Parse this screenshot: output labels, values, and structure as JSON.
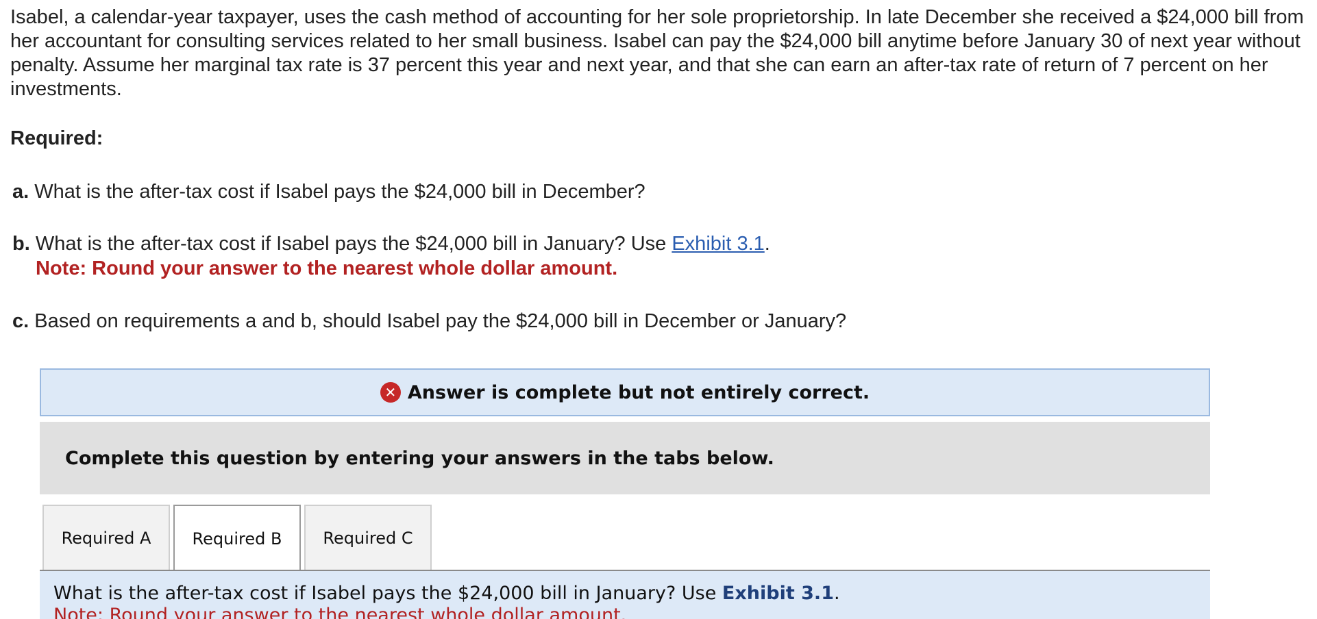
{
  "problem": {
    "text": "Isabel, a calendar-year taxpayer, uses the cash method of accounting for her sole proprietorship. In late December she received a $24,000 bill from her accountant for consulting services related to her small business. Isabel can pay the $24,000 bill anytime before January 30 of next year without penalty. Assume her marginal tax rate is 37 percent this year and next year, and that she can earn an after-tax rate of return of 7 percent on her investments."
  },
  "required": {
    "heading": "Required:",
    "a": {
      "letter": "a.",
      "text": "What is the after-tax cost if Isabel pays the $24,000 bill in December?"
    },
    "b": {
      "letter": "b.",
      "text": "What is the after-tax cost if Isabel pays the $24,000 bill in January? Use",
      "link": "Exhibit 3.1",
      "suffix": ".",
      "note": "Note: Round your answer to the nearest whole dollar amount."
    },
    "c": {
      "letter": "c.",
      "text": "Based on requirements a and b, should Isabel pay the $24,000 bill in December or January?"
    }
  },
  "answer_status": {
    "icon": "x-circle-icon",
    "text": "Answer is complete but not entirely correct."
  },
  "instruction": "Complete this question by entering your answers in the tabs below.",
  "tabs": [
    {
      "label": "Required A",
      "active": false
    },
    {
      "label": "Required B",
      "active": true
    },
    {
      "label": "Required C",
      "active": false
    }
  ],
  "panel": {
    "question": "What is the after-tax cost if Isabel pays the $24,000 bill in January? Use",
    "exhibit": "Exhibit 3.1",
    "suffix": ".",
    "note": "Note: Round your answer to the nearest whole dollar amount."
  },
  "colors": {
    "note_red": "#b22222",
    "link_blue": "#2a5db0",
    "banner_bg": "#dde9f7",
    "error_icon": "#c62828"
  }
}
